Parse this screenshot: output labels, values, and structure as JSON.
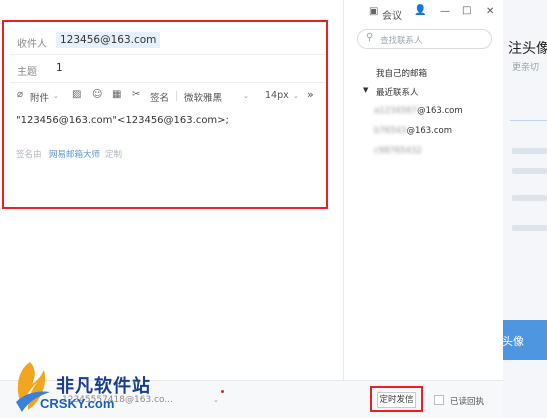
{
  "window": {
    "meeting_label": "会议",
    "minimize_glyph": "—",
    "maximize_glyph": "□",
    "close_glyph": "✕"
  },
  "compose": {
    "recipient_label": "收件人",
    "recipient_value": "123456@163.com",
    "subject_label": "主题",
    "subject_value": "1",
    "toolbar": {
      "attachment_label": "附件",
      "signature_label": "签名",
      "font_family": "微软雅黑",
      "font_size": "14px",
      "more_glyph": "»"
    },
    "body_text": "\"123456@163.com\"<123456@163.com>;",
    "signature": {
      "prefix": "签名由",
      "link": "网易邮箱大师",
      "customize": "定制"
    }
  },
  "contacts": {
    "search_placeholder": "查找联系人",
    "my_mailbox": "我自己的邮箱",
    "recent_label": "最近联系人",
    "recent_items": [
      {
        "hidden": "a1234567",
        "suffix": "@163.com"
      },
      {
        "hidden": "b76543",
        "suffix": "@163.com"
      },
      {
        "hidden": "c98765432",
        "suffix": ""
      }
    ]
  },
  "bottom": {
    "from_address": "12345557418@163.co...",
    "schedule_button": "定时发信",
    "read_receipt_label": "已读回执"
  },
  "background_window": {
    "heading": "注头像",
    "subtitle": "更亲切",
    "button_label": "头像"
  },
  "watermark": {
    "title": "非凡软件站",
    "subtitle": "CRSKY.com"
  },
  "colors": {
    "highlight_red": "#e8202a",
    "link_blue": "#5b9bd5",
    "chip_bg": "#e5f0fb",
    "brand_blue": "#4e97e0"
  }
}
